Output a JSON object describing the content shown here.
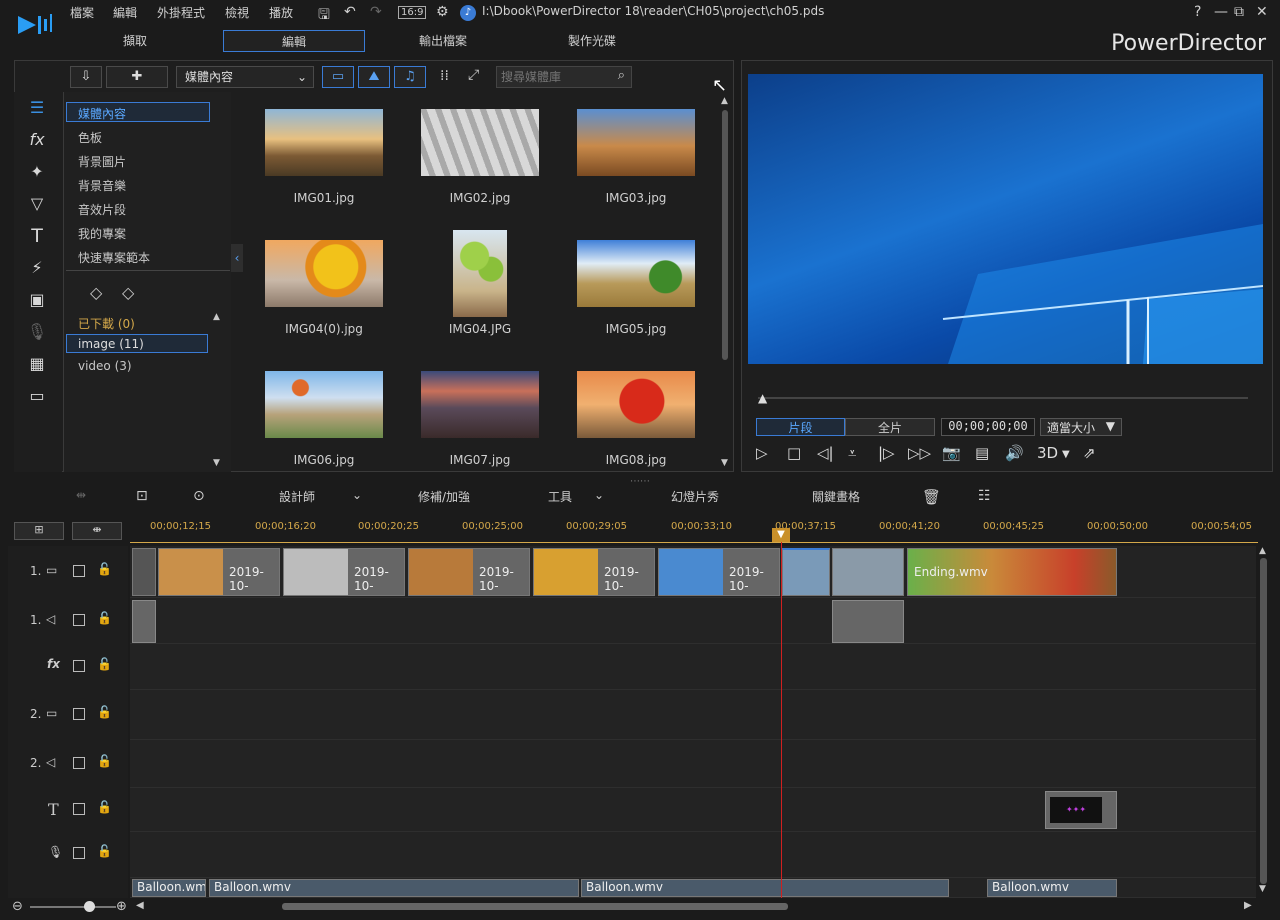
{
  "menu": [
    "檔案",
    "編輯",
    "外掛程式",
    "檢視",
    "播放"
  ],
  "aspect": "16:9",
  "project_path": "I:\\Dbook\\PowerDirector 18\\reader\\CH05\\project\\ch05.pds",
  "window_controls": [
    "?",
    "—",
    "⧉",
    "✕"
  ],
  "tabs": [
    "擷取",
    "編輯",
    "輸出檔案",
    "製作光碟"
  ],
  "brand": "PowerDirector",
  "library": {
    "dropdown": "媒體內容",
    "search_placeholder": "搜尋媒體庫",
    "tree": [
      "媒體內容",
      "色板",
      "背景圖片",
      "背景音樂",
      "音效片段",
      "我的專案",
      "快速專案範本"
    ],
    "downloaded": "已下載 (0)",
    "tags": [
      "image (11)",
      "video (3)"
    ],
    "items": [
      "IMG01.jpg",
      "IMG02.jpg",
      "IMG03.jpg",
      "IMG04(0).jpg",
      "IMG04.JPG",
      "IMG05.jpg",
      "IMG06.jpg",
      "IMG07.jpg",
      "IMG08.jpg"
    ]
  },
  "preview": {
    "mode_clip": "片段",
    "mode_full": "全片",
    "timecode": "00;00;00;00",
    "fit": "適當大小",
    "three_d": "3D"
  },
  "timeline_toolbar": {
    "designer": "設計師",
    "fix": "修補/加強",
    "tools": "工具",
    "slideshow": "幻燈片秀",
    "keyframe": "關鍵畫格"
  },
  "ruler": [
    "00;00;12;15",
    "00;00;16;20",
    "00;00;20;25",
    "00;00;25;00",
    "00;00;29;05",
    "00;00;33;10",
    "00;00;37;15",
    "00;00;41;20",
    "00;00;45;25",
    "00;00;50;00",
    "00;00;54;05"
  ],
  "tracks": [
    "1.",
    "1.",
    "fx",
    "2.",
    "2.",
    "T",
    ""
  ],
  "clip_labels": [
    "2019-10-",
    "2019-10-",
    "2019-10-",
    "2019-10-",
    "2019-10-"
  ],
  "ending_label": "Ending.wmv",
  "audio_labels": [
    "Balloon.wmv",
    "Balloon.wmv",
    "Balloon.wmv",
    "Balloon.wmv"
  ]
}
